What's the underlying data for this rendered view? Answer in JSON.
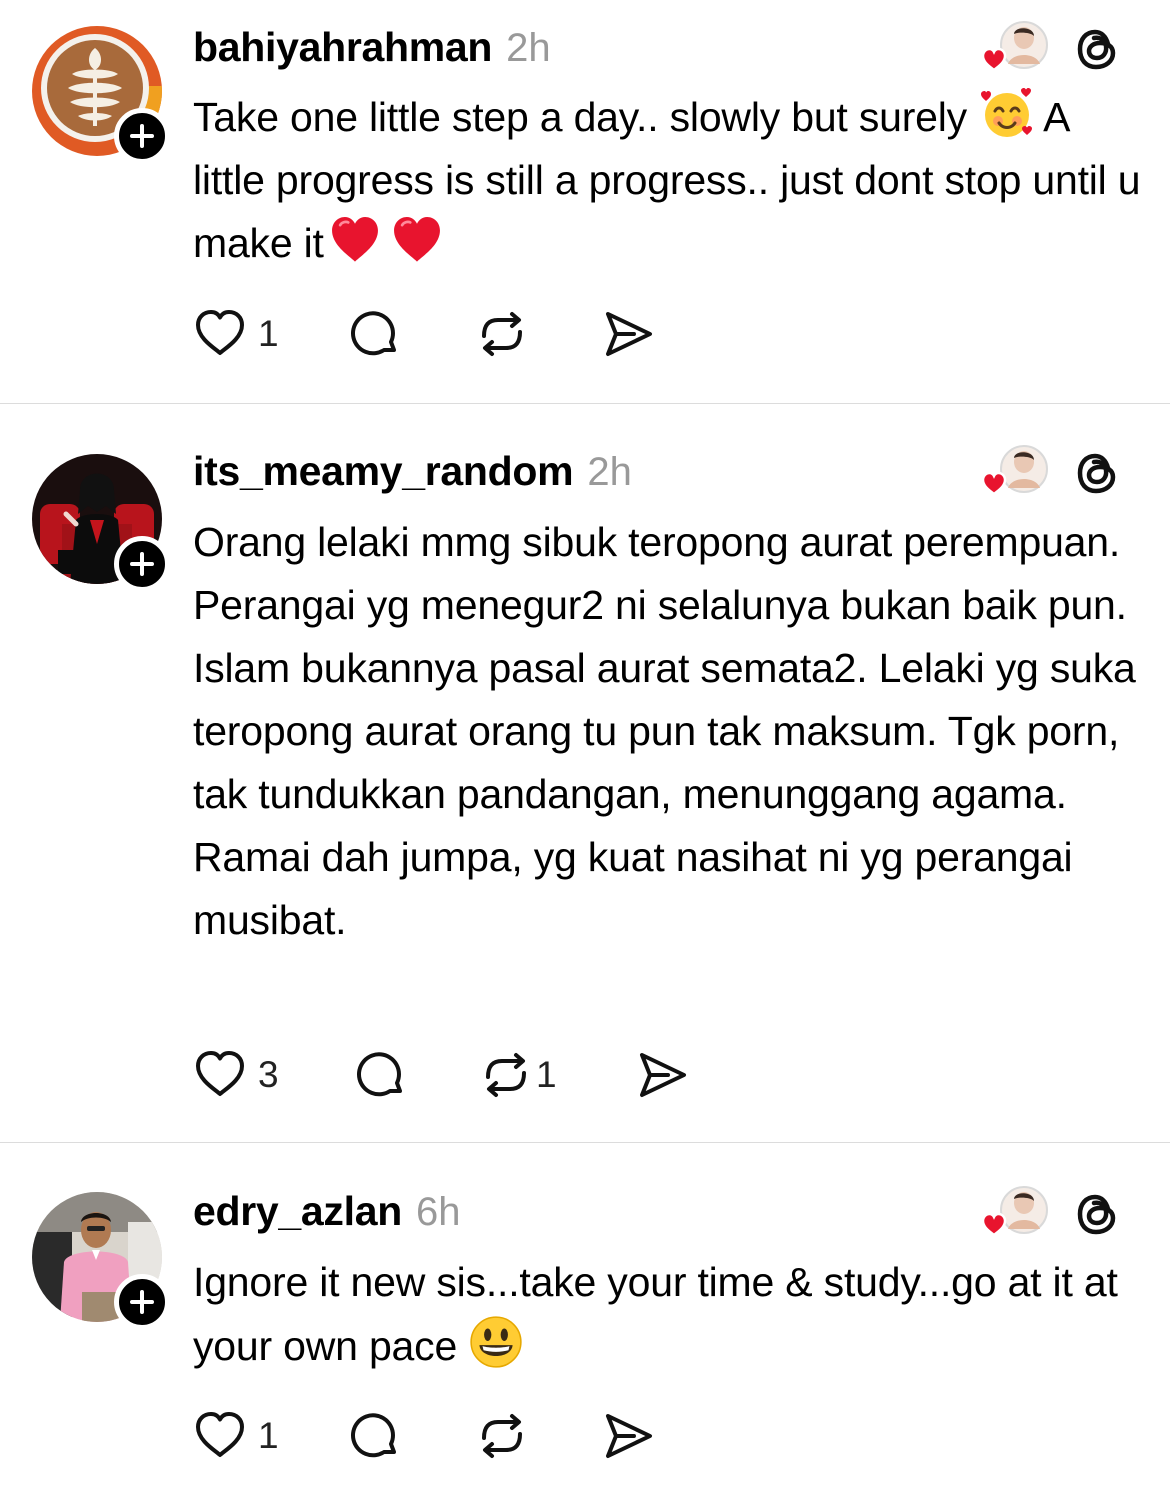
{
  "posts": [
    {
      "username": "bahiyahrahman",
      "time": "2h",
      "text_parts": [
        "Take one little step a day.. slowly but surely ",
        " A little progress is still a progress.. just dont stop until u make it"
      ],
      "likes": "1",
      "reposts": ""
    },
    {
      "username": "its_meamy_random",
      "time": "2h",
      "text_parts": [
        "Orang lelaki mmg sibuk teropong aurat perempuan. Perangai yg menegur2 ni selalunya bukan baik pun. Islam bukannya pasal aurat semata2. Lelaki yg suka teropong aurat orang tu pun tak maksum. Tgk porn, tak tundukkan pandangan, menunggang agama. Ramai dah jumpa, yg kuat nasihat ni yg perangai musibat."
      ],
      "likes": "3",
      "reposts": "1"
    },
    {
      "username": "edry_azlan",
      "time": "6h",
      "text_parts": [
        "Ignore it new sis...take your time & study...go at it at your own pace "
      ],
      "likes": "1",
      "reposts": ""
    }
  ],
  "icons": {
    "like": "heart-outline-icon",
    "comment": "comment-bubble-icon",
    "repost": "repost-arrows-icon",
    "share": "send-paper-plane-icon",
    "app": "threads-logo-icon",
    "follow": "plus-icon",
    "emoji_post1": "smiling-face-with-hearts-emoji",
    "emoji_post1_end": "red-heart-emoji",
    "emoji_post3": "grinning-face-emoji"
  },
  "colors": {
    "heart_red": "#e8142e",
    "text": "#000000",
    "muted": "#999999",
    "divider": "#dcdcdc"
  }
}
